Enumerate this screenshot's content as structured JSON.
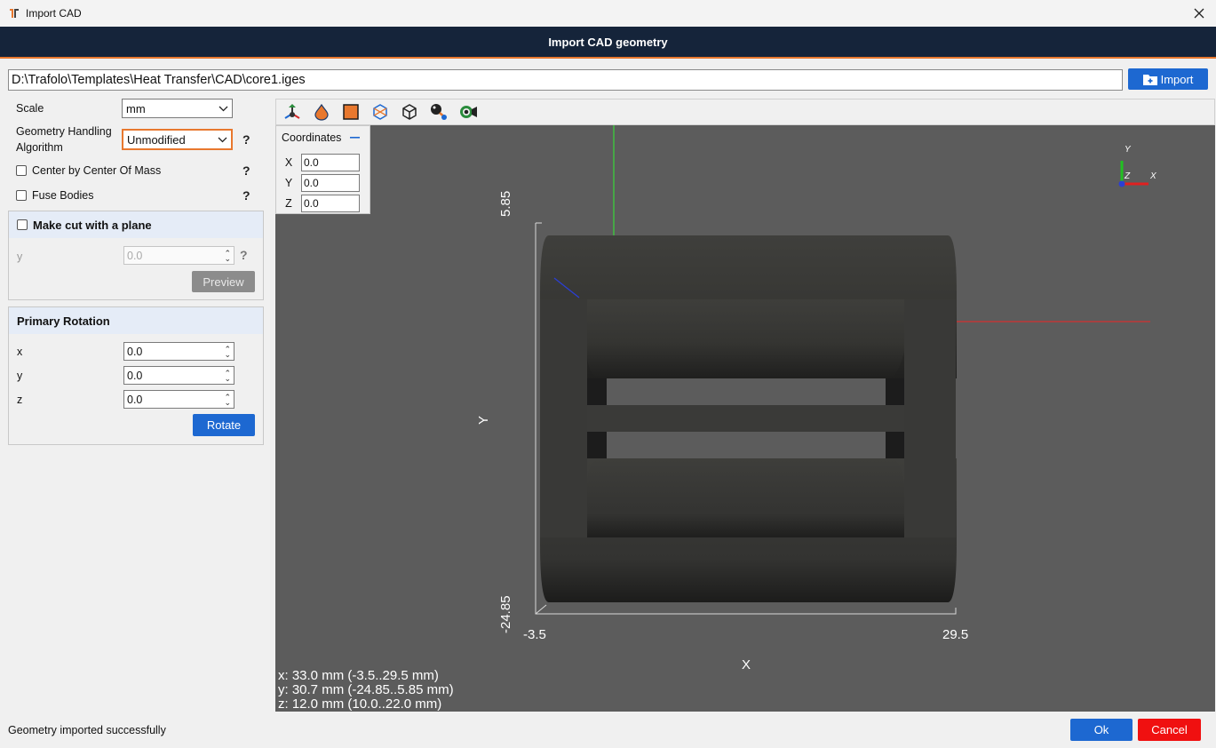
{
  "window": {
    "title": "Import CAD"
  },
  "header": {
    "title": "Import CAD geometry"
  },
  "file": {
    "path": "D:\\Trafolo\\Templates\\Heat Transfer\\CAD\\core1.iges",
    "import_label": "Import"
  },
  "settings": {
    "scale_label": "Scale",
    "scale_value": "mm",
    "algorithm_label_line1": "Geometry Handling",
    "algorithm_label_line2": "Algorithm",
    "algorithm_value": "Unmodified",
    "center_label": "Center by Center Of Mass",
    "fuse_label": "Fuse Bodies",
    "help": "?"
  },
  "cut_plane": {
    "title": "Make cut with a plane",
    "axis_label": "y",
    "value": "0.0",
    "preview_label": "Preview"
  },
  "rotation": {
    "title": "Primary Rotation",
    "x_label": "x",
    "x_value": "0.0",
    "y_label": "y",
    "y_value": "0.0",
    "z_label": "z",
    "z_value": "0.0",
    "rotate_label": "Rotate"
  },
  "coordinates": {
    "title": "Coordinates",
    "x_label": "X",
    "x_value": "0.0",
    "y_label": "Y",
    "y_value": "0.0",
    "z_label": "Z",
    "z_value": "0.0"
  },
  "viewport": {
    "y_axis_label": "Y",
    "x_axis_label": "X",
    "y_top": "5.85",
    "y_bottom": "-24.85",
    "x_left": "-3.5",
    "x_right": "29.5",
    "triad_y": "Y",
    "triad_x": "X",
    "triad_z": "Z",
    "stat_x": "x: 33.0 mm (-3.5..29.5 mm)",
    "stat_y": "y: 30.7 mm (-24.85..5.85 mm)",
    "stat_z": "z: 12.0 mm (10.0..22.0 mm)"
  },
  "status": {
    "message": "Geometry imported successfully"
  },
  "footer": {
    "ok_label": "Ok",
    "cancel_label": "Cancel"
  },
  "colors": {
    "header": "#15243a",
    "accent": "#e8782e",
    "primary": "#1d68d1",
    "danger": "#f01010",
    "viewport": "#5c5c5c"
  }
}
